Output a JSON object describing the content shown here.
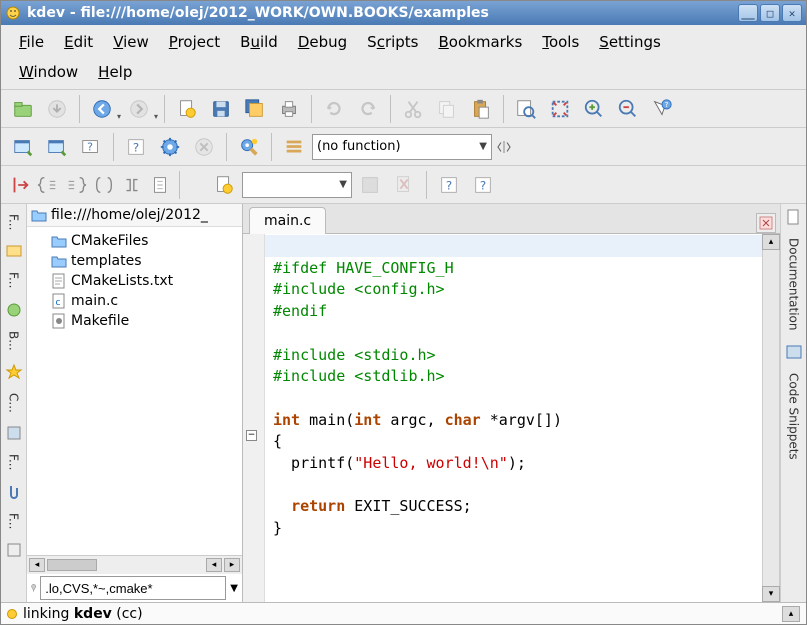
{
  "title": "kdev - file:///home/olej/2012_WORK/OWN.BOOKS/examples",
  "menu": {
    "file": "File",
    "edit": "Edit",
    "view": "View",
    "project": "Project",
    "build": "Build",
    "debug": "Debug",
    "scripts": "Scripts",
    "bookmarks": "Bookmarks",
    "tools": "Tools",
    "settings": "Settings",
    "window": "Window",
    "help": "Help"
  },
  "toolbar": {
    "function_combo": "(no function)",
    "filter_value": ".lo,CVS,*~,cmake*"
  },
  "file_panel": {
    "path": "file:///home/olej/2012_",
    "items": [
      {
        "name": "CMakeFiles",
        "type": "folder"
      },
      {
        "name": "templates",
        "type": "folder"
      },
      {
        "name": "CMakeLists.txt",
        "type": "text"
      },
      {
        "name": "main.c",
        "type": "c"
      },
      {
        "name": "Makefile",
        "type": "make"
      }
    ]
  },
  "editor": {
    "tab": "main.c",
    "lines": [
      "",
      "#ifdef HAVE_CONFIG_H",
      "#include <config.h>",
      "#endif",
      "",
      "#include <stdio.h>",
      "#include <stdlib.h>",
      "",
      "int main(int argc, char *argv[])",
      "{",
      "  printf(\"Hello, world!\\n\");",
      "",
      "  return EXIT_SUCCESS;",
      "}"
    ]
  },
  "right_tabs": {
    "doc": "Documentation",
    "snip": "Code Snippets"
  },
  "left_tabs": {
    "a": "F...",
    "b": "F...",
    "c": "B...",
    "d": "C...",
    "e": "F...",
    "f": "F..."
  },
  "output": {
    "text_prefix": "linking ",
    "text_bold": "kdev",
    "text_suffix": " (cc)"
  }
}
